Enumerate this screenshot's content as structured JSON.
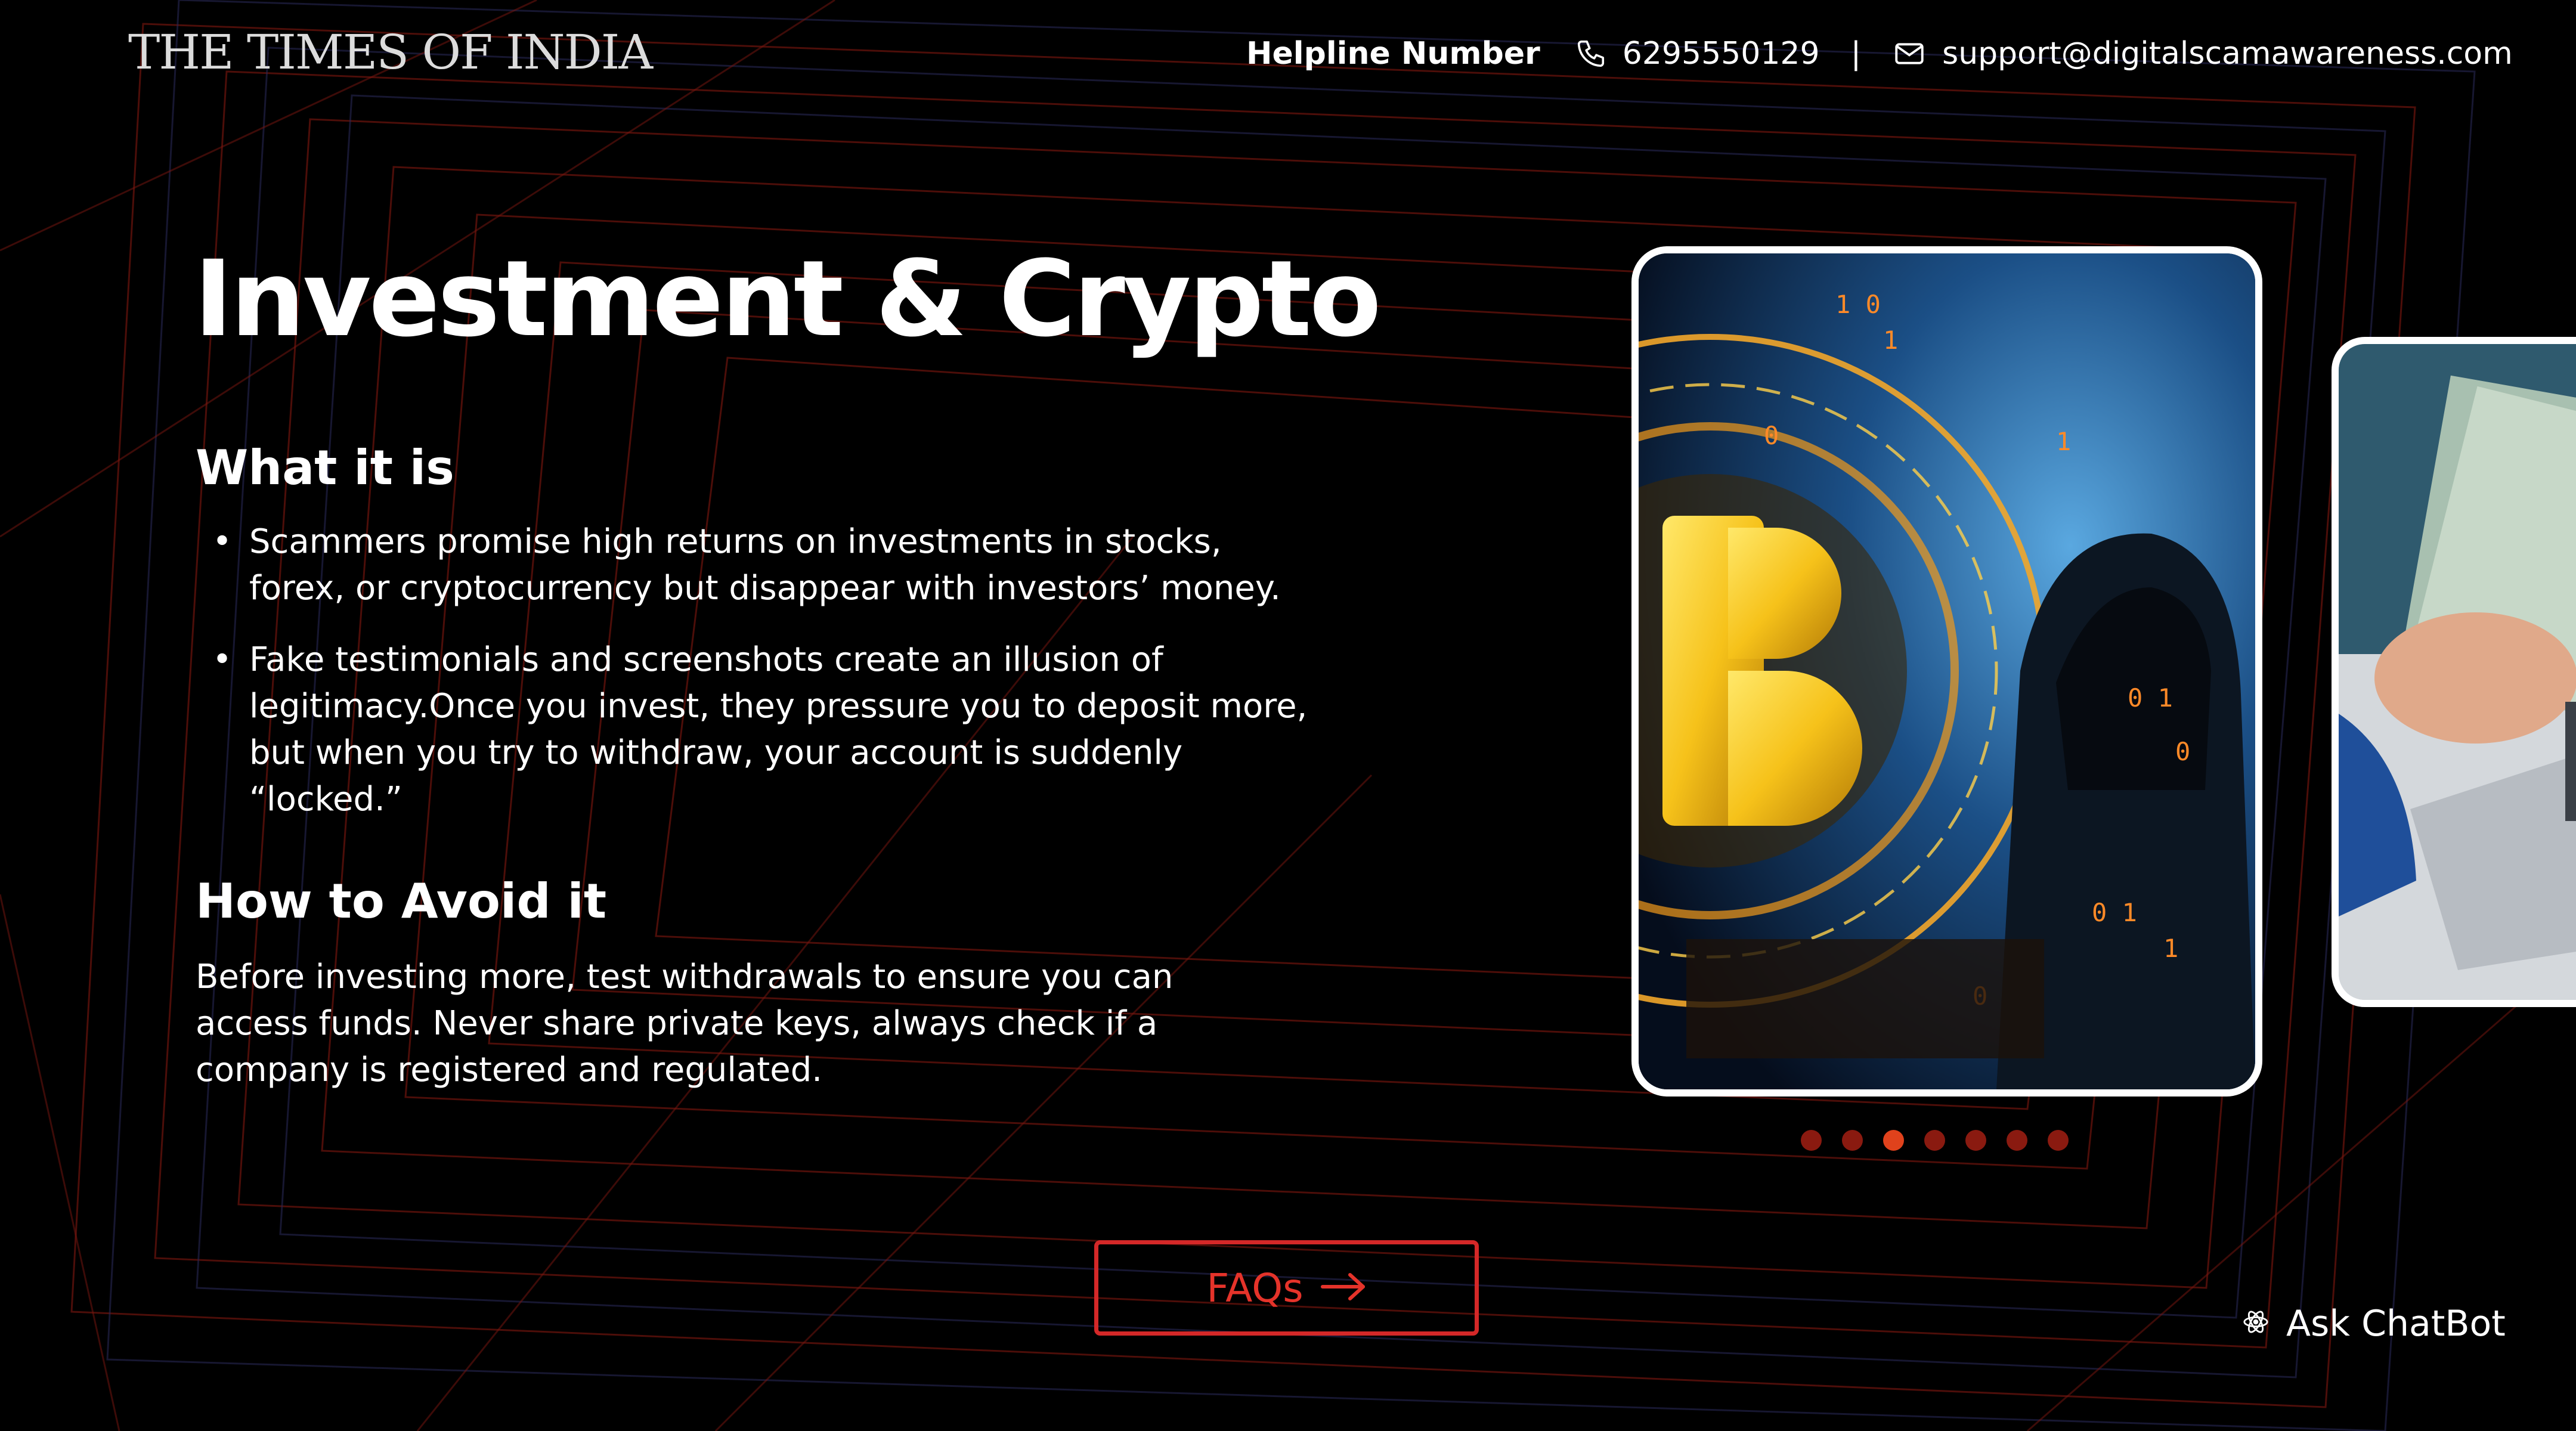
{
  "header": {
    "logo_text": "THE TIMES OF INDIA",
    "helpline_label": "Helpline Number",
    "phone": "6295550129",
    "separator": "|",
    "email": "support@digitalscamawareness.com"
  },
  "main": {
    "title": "Investment & Crypto",
    "what_heading": "What it is",
    "what_items": [
      "Scammers promise high returns on investments in stocks, forex, or cryptocurrency but disappear with investors’ money.",
      "Fake testimonials and screenshots create an illusion of legitimacy.Once you invest, they pressure you to deposit more, but when you try to withdraw, your account is suddenly “locked.”"
    ],
    "avoid_heading": "How to Avoid it",
    "avoid_text": "Before investing more, test withdrawals to ensure you can access funds. Never share private keys, always check if a company is registered and regulated."
  },
  "carousel": {
    "total_slides": 7,
    "active_index": 2,
    "main_card_image": "bitcoin-hacker-image",
    "next_card_image": "money-laptop-image"
  },
  "footer": {
    "faq_label": "FAQs",
    "chatbot_label": "Ask ChatBot"
  },
  "colors": {
    "accent_red": "#d42828",
    "dot_active": "#e0421c",
    "dot_inactive": "#8a1a10",
    "background": "#000000"
  }
}
